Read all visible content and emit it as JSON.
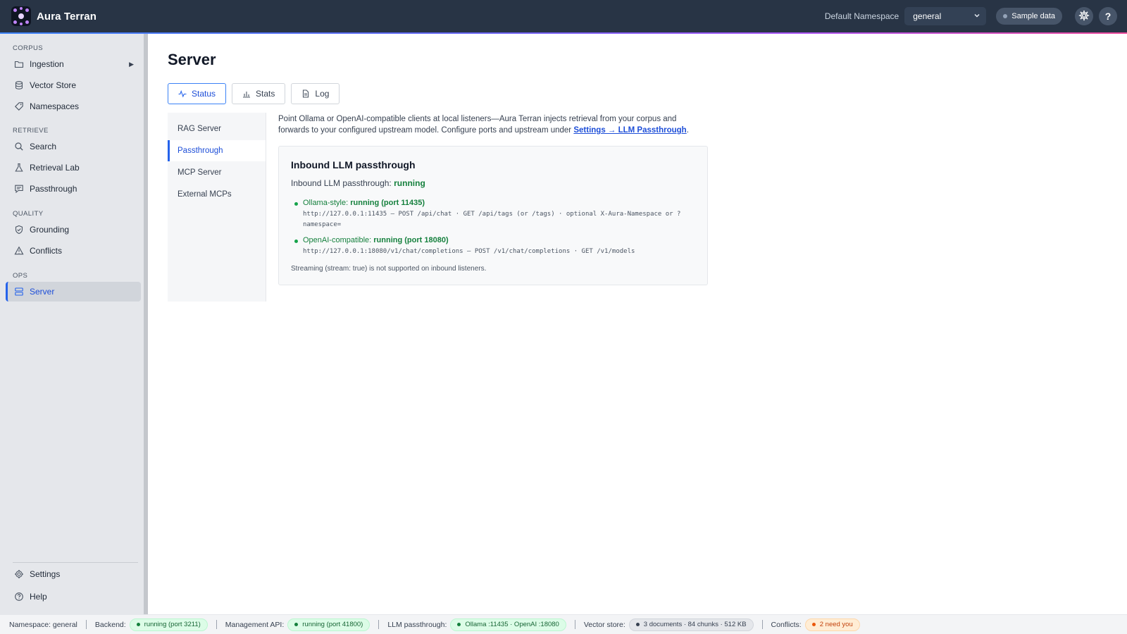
{
  "header": {
    "brand": "Aura Terran",
    "namespace_label": "Default Namespace",
    "namespace_value": "general",
    "sample_button": "Sample data",
    "settings_icon": "gear-icon",
    "help_icon": "question-icon",
    "help_glyph": "?"
  },
  "sidebar": {
    "sections": [
      {
        "title": "CORPUS",
        "items": [
          {
            "label": "Ingestion",
            "icon": "folder-icon",
            "has_submenu": true
          },
          {
            "label": "Vector Store",
            "icon": "database-icon"
          },
          {
            "label": "Namespaces",
            "icon": "tag-icon"
          }
        ]
      },
      {
        "title": "RETRIEVE",
        "items": [
          {
            "label": "Search",
            "icon": "search-icon"
          },
          {
            "label": "Retrieval Lab",
            "icon": "flask-icon"
          },
          {
            "label": "Passthrough",
            "icon": "chat-icon"
          }
        ]
      },
      {
        "title": "QUALITY",
        "items": [
          {
            "label": "Grounding",
            "icon": "shield-check-icon"
          },
          {
            "label": "Conflicts",
            "icon": "warning-icon"
          }
        ]
      },
      {
        "title": "OPS",
        "items": [
          {
            "label": "Server",
            "icon": "server-icon",
            "active": true
          }
        ]
      }
    ],
    "bottom_items": [
      {
        "label": "Settings",
        "icon": "gear-icon"
      },
      {
        "label": "Help",
        "icon": "help-circle-icon"
      }
    ]
  },
  "main": {
    "title": "Server",
    "tabs": [
      {
        "label": "Status",
        "icon": "activity-icon",
        "active": true
      },
      {
        "label": "Stats",
        "icon": "bar-chart-icon"
      },
      {
        "label": "Log",
        "icon": "file-icon"
      }
    ],
    "subnav": [
      {
        "label": "RAG Server"
      },
      {
        "label": "Passthrough",
        "active": true
      },
      {
        "label": "MCP Server"
      },
      {
        "label": "External MCPs"
      }
    ],
    "intro_text": "Point Ollama or OpenAI-compatible clients at local listeners—Aura Terran injects retrieval from your corpus and forwards to your configured upstream model. Configure ports and upstream under",
    "intro_link": "Settings → LLM Passthrough",
    "intro_end": ".",
    "card": {
      "title": "Inbound LLM passthrough",
      "status_label": "Inbound LLM passthrough:",
      "status_value": "running",
      "endpoints": [
        {
          "name": "Ollama-style:",
          "status": "running (port 11435)",
          "detail": "http://127.0.0.1:11435 — POST /api/chat · GET /api/tags (or /tags) · optional X-Aura-Namespace or ?namespace="
        },
        {
          "name": "OpenAI-compatible:",
          "status": "running (port 18080)",
          "detail": "http://127.0.0.1:18080/v1/chat/completions — POST /v1/chat/completions · GET /v1/models"
        }
      ],
      "note": "Streaming (stream: true) is not supported on inbound listeners."
    }
  },
  "footer": {
    "namespace": "Namespace: general",
    "backend_label": "Backend:",
    "backend_value": "running (port 3211)",
    "mgmt_label": "Management API:",
    "mgmt_value": "running (port 41800)",
    "llm_label": "LLM passthrough:",
    "llm_value": "Ollama :11435 · OpenAI :18080",
    "vector_label": "Vector store:",
    "vector_value": "3 documents · 84 chunks · 512 KB",
    "conflicts_label": "Conflicts:",
    "conflicts_value": "2 need you"
  },
  "colors": {
    "topbar": "#283445",
    "accent": "#2563eb",
    "success": "#15803d",
    "warning": "#ea580c"
  }
}
